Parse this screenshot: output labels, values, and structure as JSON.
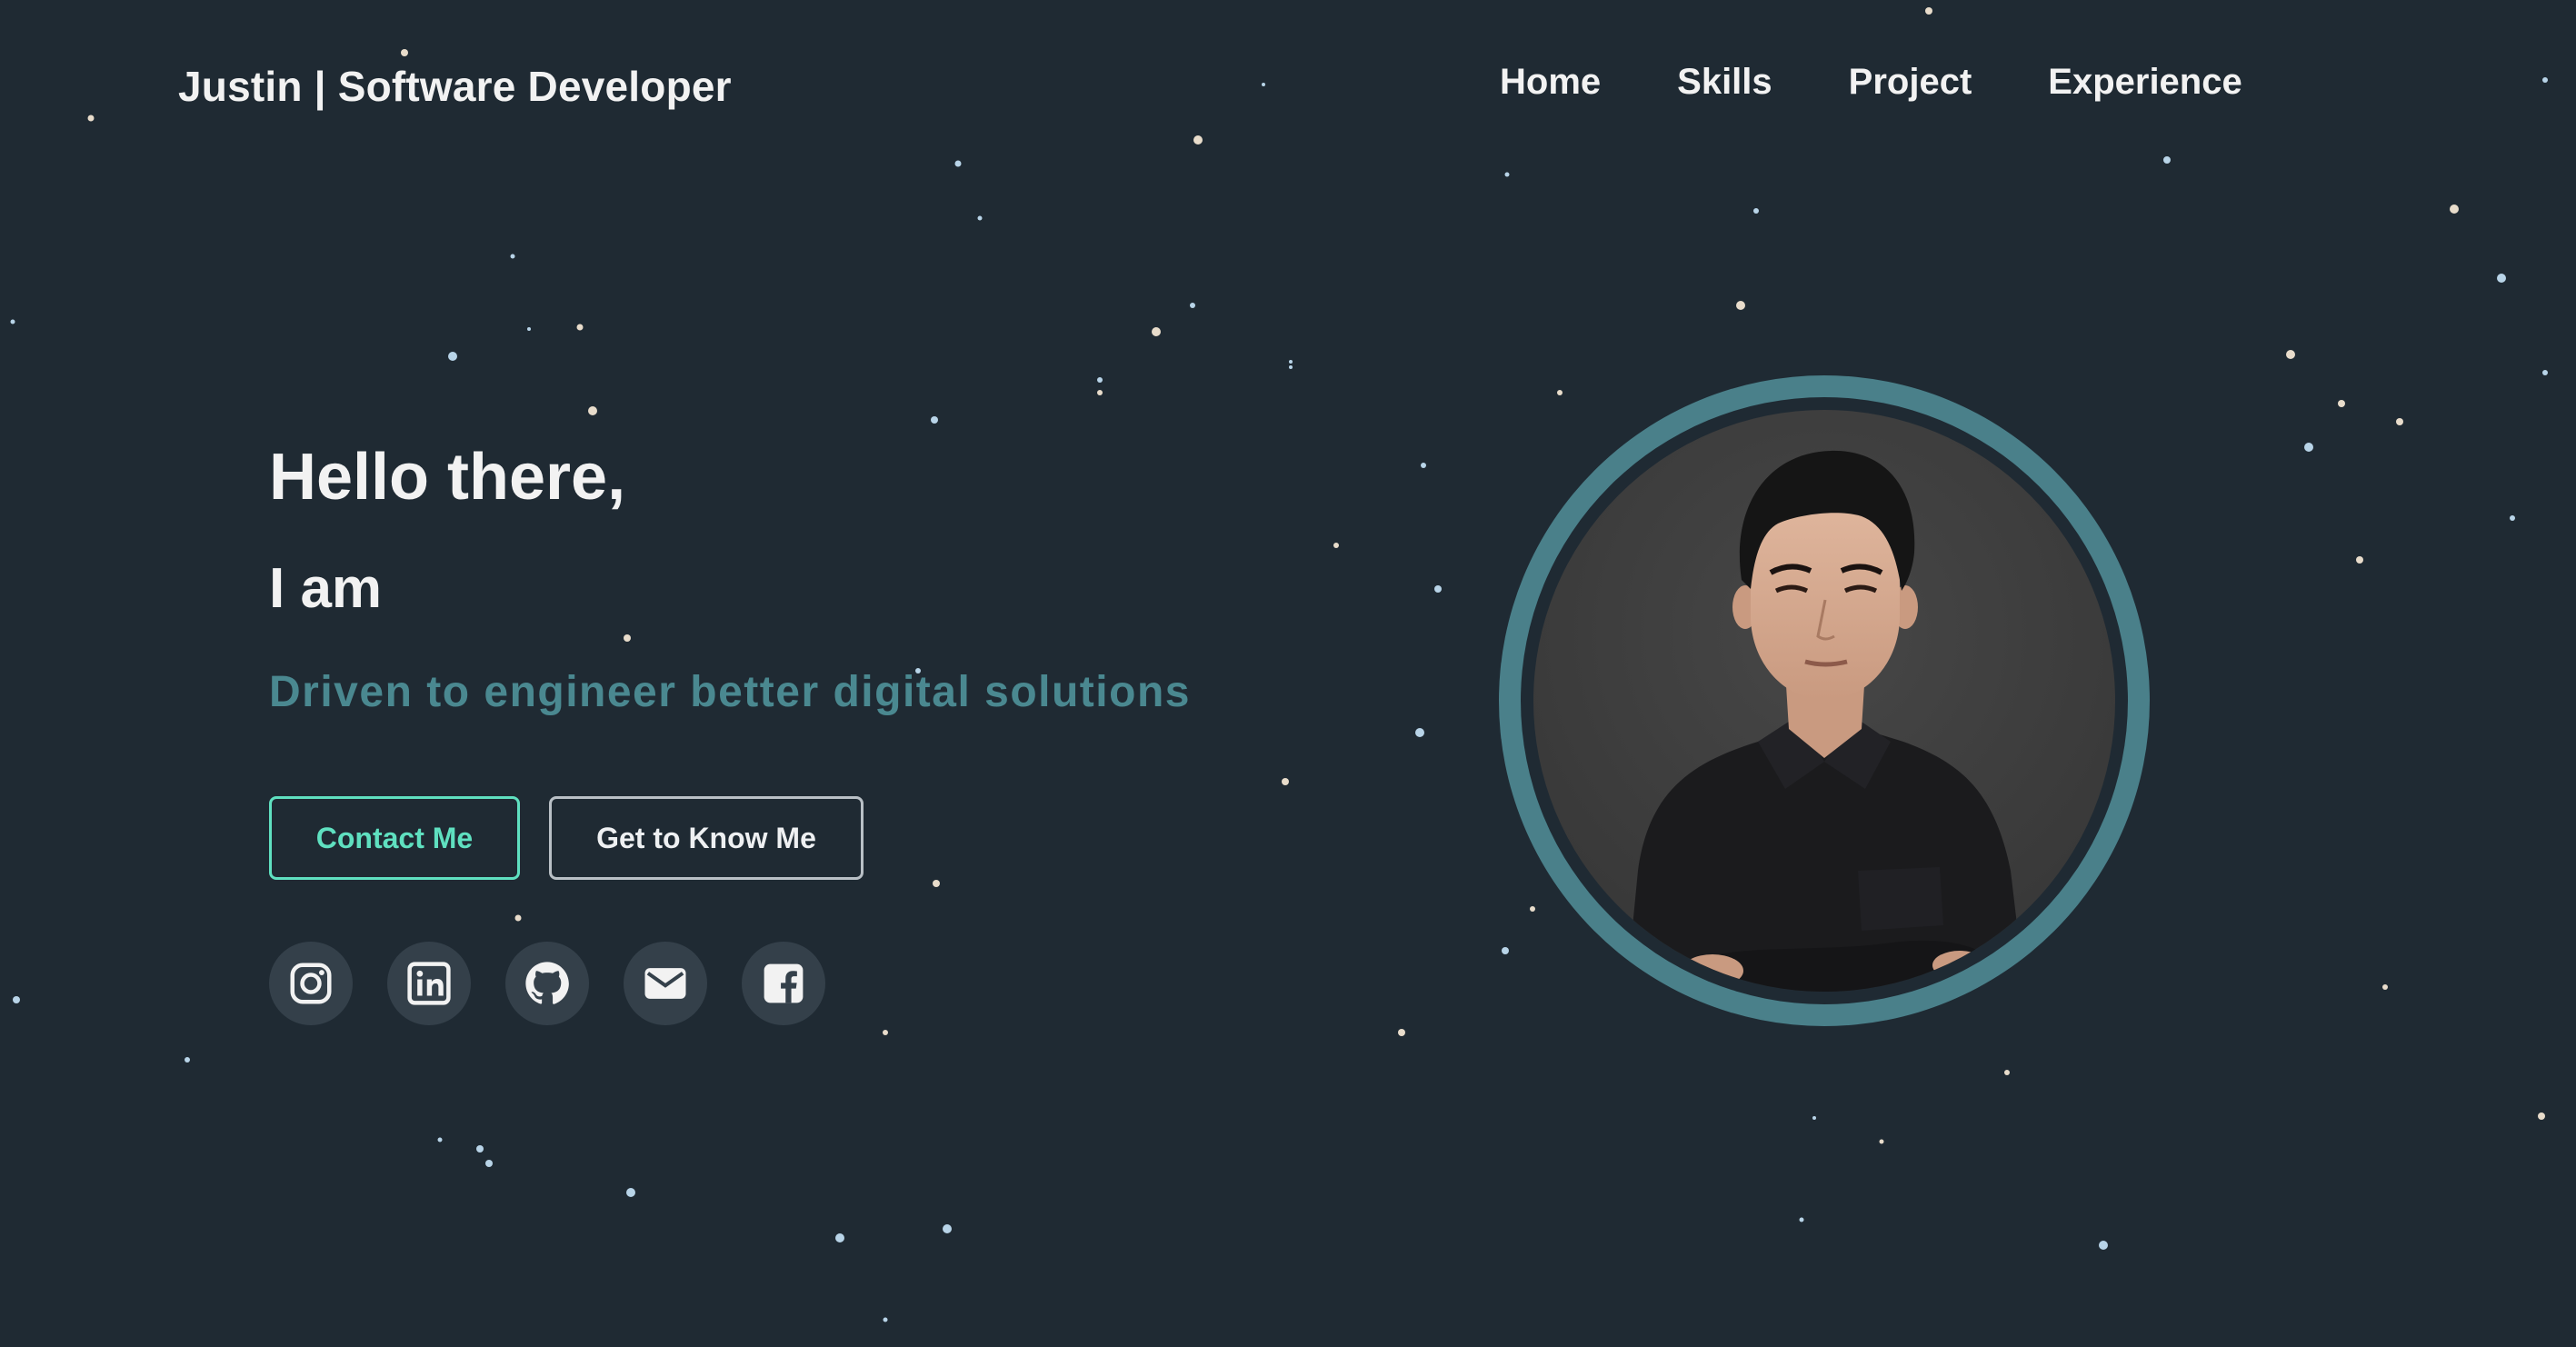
{
  "header": {
    "brand": "Justin | Software Developer",
    "nav": [
      {
        "label": "Home"
      },
      {
        "label": "Skills"
      },
      {
        "label": "Project"
      },
      {
        "label": "Experience"
      }
    ]
  },
  "hero": {
    "greeting": "Hello there,",
    "intro": "I am",
    "tagline": "Driven to engineer better digital solutions",
    "buttons": {
      "contact": "Contact Me",
      "know": "Get to Know Me"
    },
    "socials": [
      {
        "icon": "instagram-icon"
      },
      {
        "icon": "linkedin-icon"
      },
      {
        "icon": "github-icon"
      },
      {
        "icon": "email-icon"
      },
      {
        "icon": "facebook-icon"
      }
    ]
  },
  "colors": {
    "background": "#1f2a33",
    "accent": "#5fe0c0",
    "tagline": "#4a8890",
    "ring": "#4a808a"
  }
}
